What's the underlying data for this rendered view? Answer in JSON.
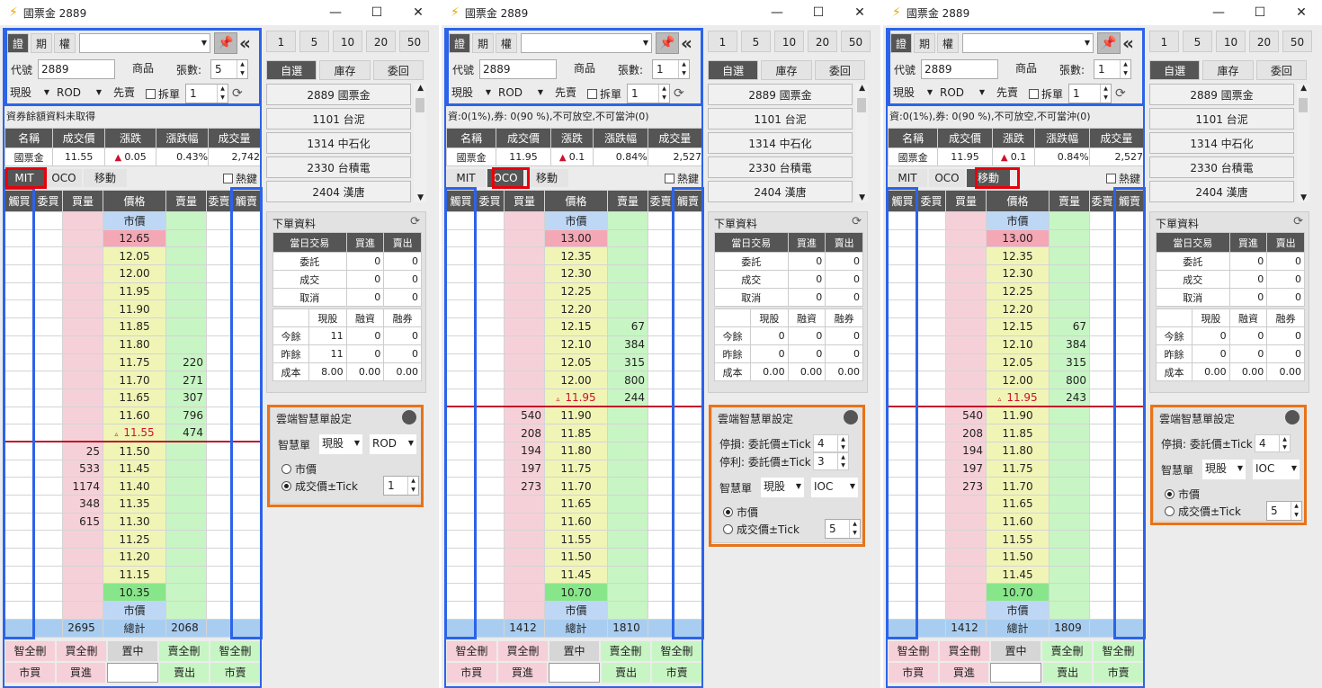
{
  "windows": [
    {
      "title": "國票金 2889",
      "market_tabs": [
        "證",
        "期",
        "權"
      ],
      "code_label": "代號",
      "code_value": "2889",
      "product_btn": "商品",
      "qty_label": "張數:",
      "qty_value": "5",
      "trade_type": "現股",
      "order_type": "ROD",
      "first_btn": "先賣",
      "split_label": "拆單",
      "split_value": "1",
      "info_text": "資券餘額資料未取得",
      "quote_headers": [
        "名稱",
        "成交價",
        "漲跌",
        "漲跌幅",
        "成交量"
      ],
      "quote_values": [
        "國票金",
        "11.55",
        "0.05",
        "0.43%",
        "2,742"
      ],
      "mode_tabs": [
        "MIT",
        "OCO",
        "移動"
      ],
      "hotkey": "熱鍵",
      "ladder_headers": [
        "觸買",
        "委買",
        "買量",
        "價格",
        "賣量",
        "委賣",
        "觸賣"
      ],
      "ladder": [
        {
          "bq": "",
          "p": "市價",
          "sq": "",
          "t": "mk"
        },
        {
          "bq": "",
          "p": "12.65",
          "sq": "",
          "t": "hi"
        },
        {
          "bq": "",
          "p": "12.05",
          "sq": "",
          "t": ""
        },
        {
          "bq": "",
          "p": "12.00",
          "sq": "",
          "t": ""
        },
        {
          "bq": "",
          "p": "11.95",
          "sq": "",
          "t": ""
        },
        {
          "bq": "",
          "p": "11.90",
          "sq": "",
          "t": ""
        },
        {
          "bq": "",
          "p": "11.85",
          "sq": "",
          "t": ""
        },
        {
          "bq": "",
          "p": "11.80",
          "sq": "",
          "t": ""
        },
        {
          "bq": "",
          "p": "11.75",
          "sq": "220",
          "t": ""
        },
        {
          "bq": "",
          "p": "11.70",
          "sq": "271",
          "t": ""
        },
        {
          "bq": "",
          "p": "11.65",
          "sq": "307",
          "t": ""
        },
        {
          "bq": "",
          "p": "11.60",
          "sq": "796",
          "t": ""
        },
        {
          "bq": "",
          "p": "11.55",
          "sq": "474",
          "t": "cur"
        },
        {
          "bq": "25",
          "p": "11.50",
          "sq": "",
          "t": "sep"
        },
        {
          "bq": "533",
          "p": "11.45",
          "sq": "",
          "t": ""
        },
        {
          "bq": "1174",
          "p": "11.40",
          "sq": "",
          "t": ""
        },
        {
          "bq": "348",
          "p": "11.35",
          "sq": "",
          "t": ""
        },
        {
          "bq": "615",
          "p": "11.30",
          "sq": "",
          "t": ""
        },
        {
          "bq": "",
          "p": "11.25",
          "sq": "",
          "t": ""
        },
        {
          "bq": "",
          "p": "11.20",
          "sq": "",
          "t": ""
        },
        {
          "bq": "",
          "p": "11.15",
          "sq": "",
          "t": ""
        },
        {
          "bq": "",
          "p": "10.35",
          "sq": "",
          "t": "lo"
        },
        {
          "bq": "",
          "p": "市價",
          "sq": "",
          "t": "mk"
        },
        {
          "bq": "2695",
          "p": "總計",
          "sq": "2068",
          "t": "tot"
        }
      ],
      "bottom_row1": [
        "智全刪",
        "買全刪",
        "置中",
        "賣全刪",
        "智全刪"
      ],
      "bottom_row2": [
        "市買",
        "買進",
        "",
        "賣出",
        "市賣"
      ],
      "qty_btns": [
        "1",
        "5",
        "10",
        "20",
        "50"
      ],
      "right_tabs": [
        "自選",
        "庫存",
        "委回"
      ],
      "stocks": [
        "2889 國票金",
        "1101 台泥",
        "1314 中石化",
        "2330 台積電",
        "2404 漢唐"
      ],
      "order_title": "下單資料",
      "order_headers": [
        "當日交易",
        "買進",
        "賣出"
      ],
      "order_rows": [
        [
          "委託",
          "0",
          "0"
        ],
        [
          "成交",
          "0",
          "0"
        ],
        [
          "取消",
          "0",
          "0"
        ]
      ],
      "pos_headers": [
        "現股",
        "融資",
        "融券"
      ],
      "pos_rows": [
        [
          "今餘",
          "11",
          "0",
          "0"
        ],
        [
          "昨餘",
          "11",
          "0",
          "0"
        ],
        [
          "成本",
          "8.00",
          "0.00",
          "0.00"
        ]
      ],
      "smart_title": "雲端智慧單設定",
      "smart": {
        "lines": [],
        "label": "智慧單",
        "type": "現股",
        "ord": "ROD",
        "radio1": "市價",
        "radio2": "成交價±Tick",
        "tick": "1",
        "sel": 2
      }
    },
    {
      "title": "國票金 2889",
      "market_tabs": [
        "證",
        "期",
        "權"
      ],
      "code_label": "代號",
      "code_value": "2889",
      "product_btn": "商品",
      "qty_label": "張數:",
      "qty_value": "1",
      "trade_type": "現股",
      "order_type": "ROD",
      "first_btn": "先賣",
      "split_label": "拆單",
      "split_value": "1",
      "info_text": "資:0(1%),券: 0(90 %),不可放空,不可當沖(0)",
      "quote_headers": [
        "名稱",
        "成交價",
        "漲跌",
        "漲跌幅",
        "成交量"
      ],
      "quote_values": [
        "國票金",
        "11.95",
        "0.1",
        "0.84%",
        "2,527"
      ],
      "mode_tabs": [
        "MIT",
        "OCO",
        "移動"
      ],
      "hotkey": "熱鍵",
      "ladder_headers": [
        "觸買",
        "委買",
        "買量",
        "價格",
        "賣量",
        "委賣",
        "觸賣"
      ],
      "ladder": [
        {
          "bq": "",
          "p": "市價",
          "sq": "",
          "t": "mk"
        },
        {
          "bq": "",
          "p": "13.00",
          "sq": "",
          "t": "hi"
        },
        {
          "bq": "",
          "p": "12.35",
          "sq": "",
          "t": ""
        },
        {
          "bq": "",
          "p": "12.30",
          "sq": "",
          "t": ""
        },
        {
          "bq": "",
          "p": "12.25",
          "sq": "",
          "t": ""
        },
        {
          "bq": "",
          "p": "12.20",
          "sq": "",
          "t": ""
        },
        {
          "bq": "",
          "p": "12.15",
          "sq": "67",
          "t": ""
        },
        {
          "bq": "",
          "p": "12.10",
          "sq": "384",
          "t": ""
        },
        {
          "bq": "",
          "p": "12.05",
          "sq": "315",
          "t": ""
        },
        {
          "bq": "",
          "p": "12.00",
          "sq": "800",
          "t": ""
        },
        {
          "bq": "",
          "p": "11.95",
          "sq": "244",
          "t": "cur"
        },
        {
          "bq": "540",
          "p": "11.90",
          "sq": "",
          "t": "sep"
        },
        {
          "bq": "208",
          "p": "11.85",
          "sq": "",
          "t": ""
        },
        {
          "bq": "194",
          "p": "11.80",
          "sq": "",
          "t": ""
        },
        {
          "bq": "197",
          "p": "11.75",
          "sq": "",
          "t": ""
        },
        {
          "bq": "273",
          "p": "11.70",
          "sq": "",
          "t": ""
        },
        {
          "bq": "",
          "p": "11.65",
          "sq": "",
          "t": ""
        },
        {
          "bq": "",
          "p": "11.60",
          "sq": "",
          "t": ""
        },
        {
          "bq": "",
          "p": "11.55",
          "sq": "",
          "t": ""
        },
        {
          "bq": "",
          "p": "11.50",
          "sq": "",
          "t": ""
        },
        {
          "bq": "",
          "p": "11.45",
          "sq": "",
          "t": ""
        },
        {
          "bq": "",
          "p": "10.70",
          "sq": "",
          "t": "lo"
        },
        {
          "bq": "",
          "p": "市價",
          "sq": "",
          "t": "mk"
        },
        {
          "bq": "1412",
          "p": "總計",
          "sq": "1810",
          "t": "tot"
        }
      ],
      "bottom_row1": [
        "智全刪",
        "買全刪",
        "置中",
        "賣全刪",
        "智全刪"
      ],
      "bottom_row2": [
        "市買",
        "買進",
        "",
        "賣出",
        "市賣"
      ],
      "qty_btns": [
        "1",
        "5",
        "10",
        "20",
        "50"
      ],
      "right_tabs": [
        "自選",
        "庫存",
        "委回"
      ],
      "stocks": [
        "2889 國票金",
        "1101 台泥",
        "1314 中石化",
        "2330 台積電",
        "2404 漢唐"
      ],
      "order_title": "下單資料",
      "order_headers": [
        "當日交易",
        "買進",
        "賣出"
      ],
      "order_rows": [
        [
          "委託",
          "0",
          "0"
        ],
        [
          "成交",
          "0",
          "0"
        ],
        [
          "取消",
          "0",
          "0"
        ]
      ],
      "pos_headers": [
        "現股",
        "融資",
        "融券"
      ],
      "pos_rows": [
        [
          "今餘",
          "0",
          "0",
          "0"
        ],
        [
          "昨餘",
          "0",
          "0",
          "0"
        ],
        [
          "成本",
          "0.00",
          "0.00",
          "0.00"
        ]
      ],
      "smart_title": "雲端智慧單設定",
      "smart": {
        "lines": [
          [
            "停損: 委託價±Tick",
            "4"
          ],
          [
            "停利: 委託價±Tick",
            "3"
          ]
        ],
        "label": "智慧單",
        "type": "現股",
        "ord": "IOC",
        "radio1": "市價",
        "radio2": "成交價±Tick",
        "tick": "5",
        "sel": 1
      }
    },
    {
      "title": "國票金 2889",
      "market_tabs": [
        "證",
        "期",
        "權"
      ],
      "code_label": "代號",
      "code_value": "2889",
      "product_btn": "商品",
      "qty_label": "張數:",
      "qty_value": "1",
      "trade_type": "現股",
      "order_type": "ROD",
      "first_btn": "先賣",
      "split_label": "拆單",
      "split_value": "1",
      "info_text": "資:0(1%),券: 0(90 %),不可放空,不可當沖(0)",
      "quote_headers": [
        "名稱",
        "成交價",
        "漲跌",
        "漲跌幅",
        "成交量"
      ],
      "quote_values": [
        "國票金",
        "11.95",
        "0.1",
        "0.84%",
        "2,527"
      ],
      "mode_tabs": [
        "MIT",
        "OCO",
        "移動"
      ],
      "hotkey": "熱鍵",
      "ladder_headers": [
        "觸買",
        "委買",
        "買量",
        "價格",
        "賣量",
        "委賣",
        "觸賣"
      ],
      "ladder": [
        {
          "bq": "",
          "p": "市價",
          "sq": "",
          "t": "mk"
        },
        {
          "bq": "",
          "p": "13.00",
          "sq": "",
          "t": "hi"
        },
        {
          "bq": "",
          "p": "12.35",
          "sq": "",
          "t": ""
        },
        {
          "bq": "",
          "p": "12.30",
          "sq": "",
          "t": ""
        },
        {
          "bq": "",
          "p": "12.25",
          "sq": "",
          "t": ""
        },
        {
          "bq": "",
          "p": "12.20",
          "sq": "",
          "t": ""
        },
        {
          "bq": "",
          "p": "12.15",
          "sq": "67",
          "t": ""
        },
        {
          "bq": "",
          "p": "12.10",
          "sq": "384",
          "t": ""
        },
        {
          "bq": "",
          "p": "12.05",
          "sq": "315",
          "t": ""
        },
        {
          "bq": "",
          "p": "12.00",
          "sq": "800",
          "t": ""
        },
        {
          "bq": "",
          "p": "11.95",
          "sq": "243",
          "t": "cur"
        },
        {
          "bq": "540",
          "p": "11.90",
          "sq": "",
          "t": "sep"
        },
        {
          "bq": "208",
          "p": "11.85",
          "sq": "",
          "t": ""
        },
        {
          "bq": "194",
          "p": "11.80",
          "sq": "",
          "t": ""
        },
        {
          "bq": "197",
          "p": "11.75",
          "sq": "",
          "t": ""
        },
        {
          "bq": "273",
          "p": "11.70",
          "sq": "",
          "t": ""
        },
        {
          "bq": "",
          "p": "11.65",
          "sq": "",
          "t": ""
        },
        {
          "bq": "",
          "p": "11.60",
          "sq": "",
          "t": ""
        },
        {
          "bq": "",
          "p": "11.55",
          "sq": "",
          "t": ""
        },
        {
          "bq": "",
          "p": "11.50",
          "sq": "",
          "t": ""
        },
        {
          "bq": "",
          "p": "11.45",
          "sq": "",
          "t": ""
        },
        {
          "bq": "",
          "p": "10.70",
          "sq": "",
          "t": "lo"
        },
        {
          "bq": "",
          "p": "市價",
          "sq": "",
          "t": "mk"
        },
        {
          "bq": "1412",
          "p": "總計",
          "sq": "1809",
          "t": "tot"
        }
      ],
      "bottom_row1": [
        "智全刪",
        "買全刪",
        "置中",
        "賣全刪",
        "智全刪"
      ],
      "bottom_row2": [
        "市買",
        "買進",
        "",
        "賣出",
        "市賣"
      ],
      "qty_btns": [
        "1",
        "5",
        "10",
        "20",
        "50"
      ],
      "right_tabs": [
        "自選",
        "庫存",
        "委回"
      ],
      "stocks": [
        "2889 國票金",
        "1101 台泥",
        "1314 中石化",
        "2330 台積電",
        "2404 漢唐"
      ],
      "order_title": "下單資料",
      "order_headers": [
        "當日交易",
        "買進",
        "賣出"
      ],
      "order_rows": [
        [
          "委託",
          "0",
          "0"
        ],
        [
          "成交",
          "0",
          "0"
        ],
        [
          "取消",
          "0",
          "0"
        ]
      ],
      "pos_headers": [
        "現股",
        "融資",
        "融券"
      ],
      "pos_rows": [
        [
          "今餘",
          "0",
          "0",
          "0"
        ],
        [
          "昨餘",
          "0",
          "0",
          "0"
        ],
        [
          "成本",
          "0.00",
          "0.00",
          "0.00"
        ]
      ],
      "smart_title": "雲端智慧單設定",
      "smart": {
        "lines": [
          [
            "停損: 委託價±Tick",
            "4"
          ]
        ],
        "label": "智慧單",
        "type": "現股",
        "ord": "IOC",
        "radio1": "市價",
        "radio2": "成交價±Tick",
        "tick": "5",
        "sel": 1
      }
    }
  ]
}
